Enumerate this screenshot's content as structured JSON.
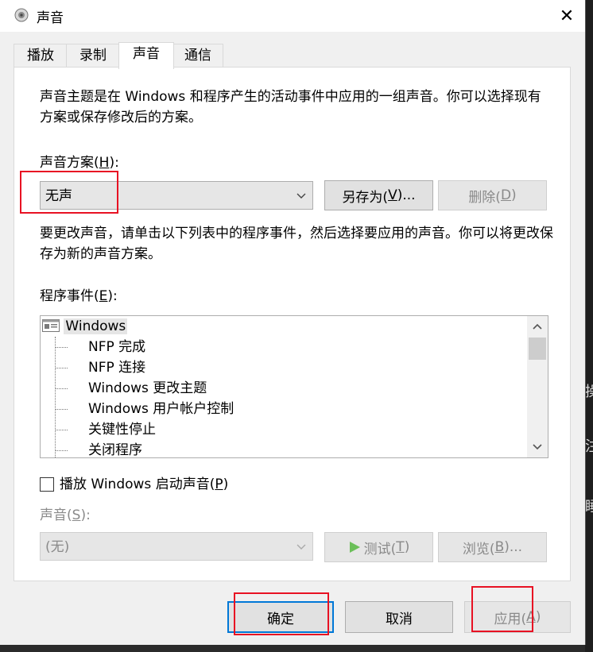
{
  "window": {
    "title": "声音",
    "close_icon": "✕"
  },
  "tabs": [
    {
      "label": "播放"
    },
    {
      "label": "录制"
    },
    {
      "label": "声音"
    },
    {
      "label": "通信"
    }
  ],
  "sounds_tab": {
    "intro": "声音主题是在 Windows 和程序产生的活动事件中应用的一组声音。你可以选择现有方案或保存修改后的方案。",
    "scheme_label_prefix": "声音方案(",
    "scheme_label_key": "H",
    "scheme_label_suffix": "):",
    "scheme_value": "无声",
    "save_as_prefix": "另存为(",
    "save_as_key": "V",
    "save_as_suffix": ")...",
    "delete_prefix": "删除(",
    "delete_key": "D",
    "delete_suffix": ")",
    "instructions": "要更改声音，请单击以下列表中的程序事件，然后选择要应用的声音。你可以将更改保存为新的声音方案。",
    "events_label_prefix": "程序事件(",
    "events_label_key": "E",
    "events_label_suffix": "):",
    "events_root": "Windows",
    "events": [
      "NFP 完成",
      "NFP 连接",
      "Windows 更改主题",
      "Windows 用户帐户控制",
      "关键性停止",
      "关闭程序"
    ],
    "startup_checkbox_prefix": "播放 Windows 启动声音(",
    "startup_checkbox_key": "P",
    "startup_checkbox_suffix": ")",
    "startup_checked": false,
    "sound_label_prefix": "声音(",
    "sound_label_key": "S",
    "sound_label_suffix": "):",
    "sound_value": "(无)",
    "test_prefix": "测试(",
    "test_key": "T",
    "test_suffix": ")",
    "browse_prefix": "浏览(",
    "browse_key": "B",
    "browse_suffix": ")..."
  },
  "footer": {
    "ok": "确定",
    "cancel": "取消",
    "apply_prefix": "应用(",
    "apply_key": "A",
    "apply_suffix": ")"
  },
  "background_hints": [
    "操作",
    "注",
    "睡眠"
  ],
  "colors": {
    "accent": "#0078d7",
    "annotation": "#e81123"
  }
}
